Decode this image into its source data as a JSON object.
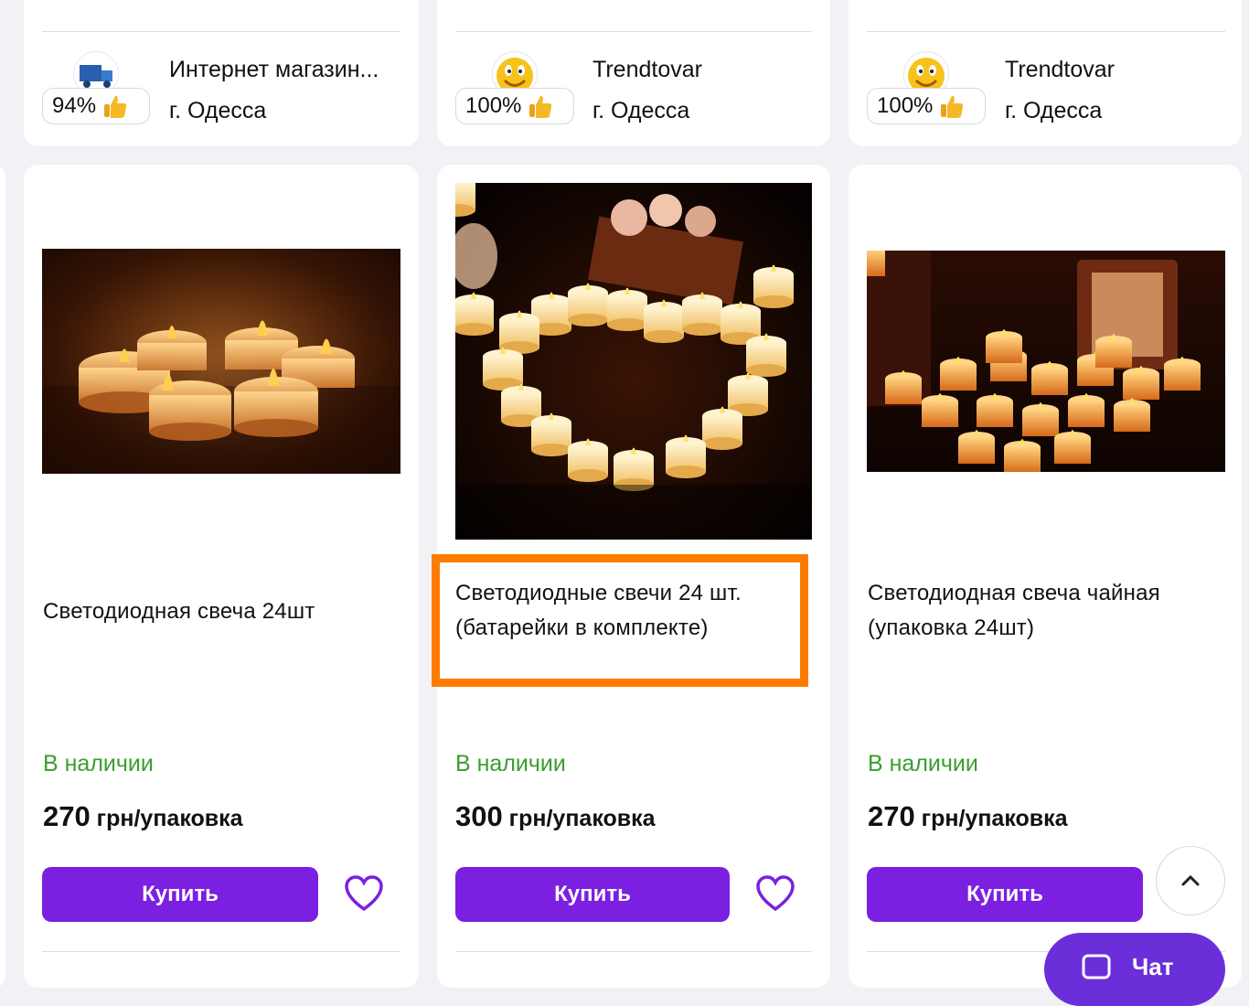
{
  "top_row": [
    {
      "seller_name": "Интернет магазин...",
      "rating": "94%",
      "city": "г. Одесса",
      "logo_icon": "truck-store-logo"
    },
    {
      "seller_name": "Trendtovar",
      "rating": "100%",
      "city": "г. Одесса",
      "logo_icon": "smiley-face-logo"
    },
    {
      "seller_name": "Trendtovar",
      "rating": "100%",
      "city": "г. Одесса",
      "logo_icon": "smiley-face-logo"
    }
  ],
  "products": [
    {
      "title_line1": "Светодиодная свеча 24шт",
      "title_line2": "",
      "stock": "В наличии",
      "price_amount": "270",
      "price_unit": " грн/упаковка",
      "buy_label": "Купить"
    },
    {
      "title_line1": "Светодиодные свечи 24 шт.",
      "title_line2": "(батарейки в комплекте)",
      "stock": "В наличии",
      "price_amount": "300",
      "price_unit": " грн/упаковка",
      "buy_label": "Купить"
    },
    {
      "title_line1": "Светодиодная свеча чайная",
      "title_line2": "(упаковка 24шт)",
      "stock": "В наличии",
      "price_amount": "270",
      "price_unit": " грн/упаковка",
      "buy_label": "Купить"
    }
  ],
  "chat": {
    "label": "Чат"
  },
  "colors": {
    "accent": "#7b1fe0",
    "stock": "#3a9d2e",
    "highlight": "#ff7b00"
  }
}
